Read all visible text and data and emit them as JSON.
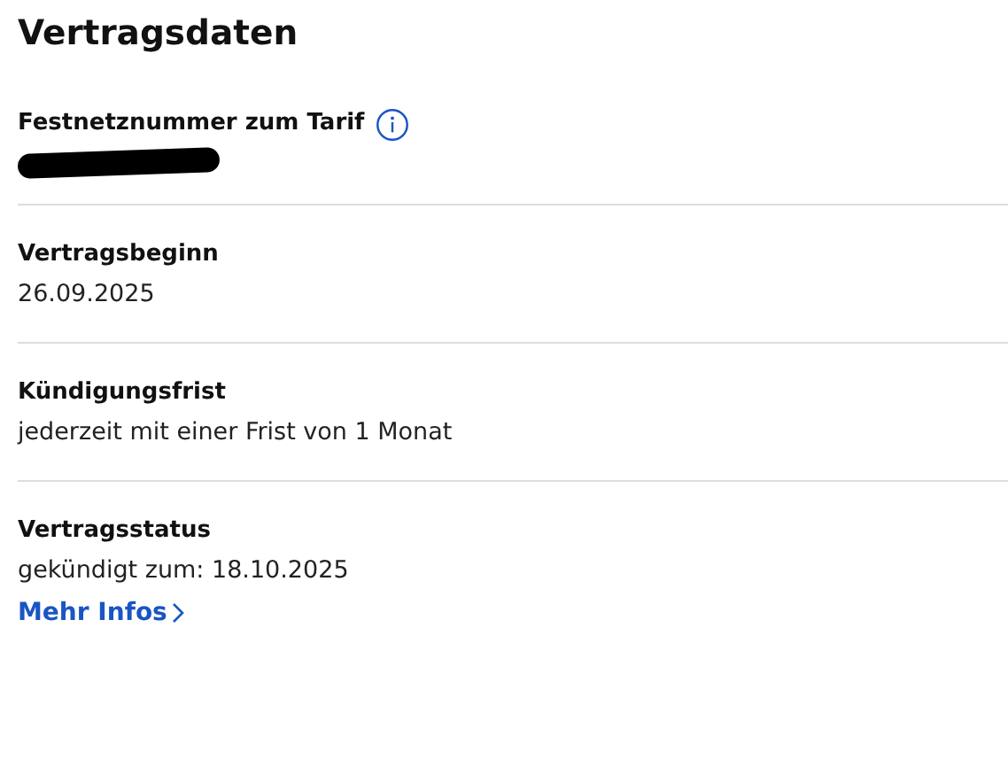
{
  "title": "Vertragsdaten",
  "items": [
    {
      "label": "Festnetznummer zum Tarif",
      "info": true,
      "redacted": true
    },
    {
      "label": "Vertragsbeginn",
      "value": "26.09.2025"
    },
    {
      "label": "Kündigungsfrist",
      "value": "jederzeit mit einer Frist von 1 Monat"
    },
    {
      "label": "Vertragsstatus",
      "value": "gekündigt zum: 18.10.2025",
      "link": "Mehr Infos"
    }
  ]
}
